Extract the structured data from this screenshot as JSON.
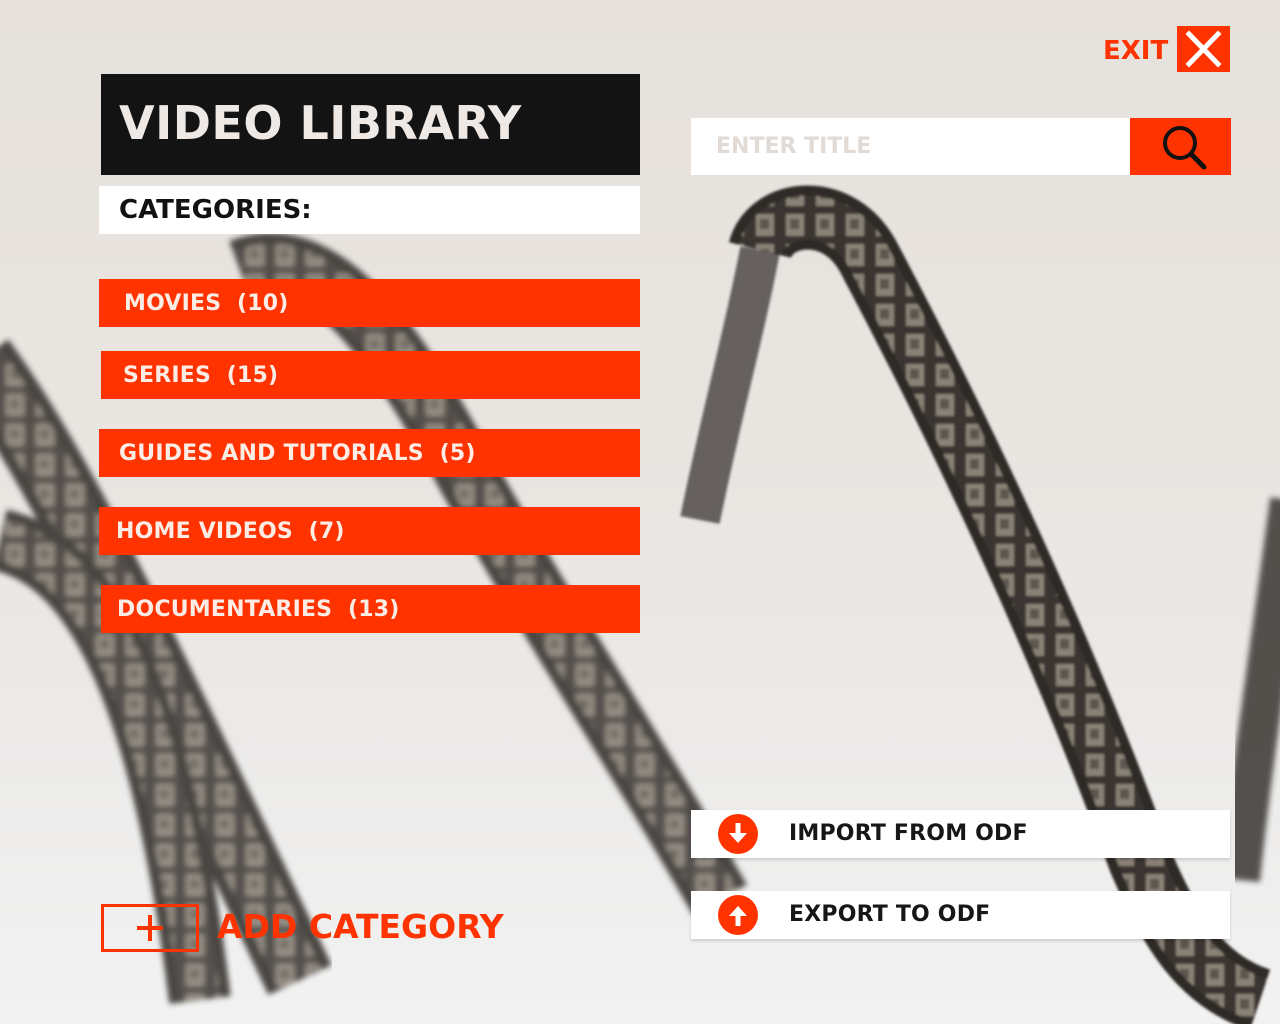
{
  "header": {
    "title": "VIDEO LIBRARY",
    "categories_heading": "CATEGORIES:"
  },
  "exit": {
    "label": "EXIT",
    "icon": "close-icon"
  },
  "search": {
    "placeholder": "ENTER TITLE",
    "value": "",
    "icon": "search-icon"
  },
  "categories": [
    {
      "label": "MOVIES  (10)"
    },
    {
      "label": "SERIES  (15)"
    },
    {
      "label": "GUIDES AND TUTORIALS  (5)"
    },
    {
      "label": "HOME VIDEOS  (7)"
    },
    {
      "label": "DOCUMENTARIES  (13)"
    }
  ],
  "actions": {
    "import_label": "IMPORT FROM ODF",
    "import_icon": "download-arrow-icon",
    "export_label": "EXPORT TO ODF",
    "export_icon": "upload-arrow-icon"
  },
  "add_category": {
    "label": "ADD CATEGORY",
    "icon": "plus-icon"
  },
  "colors": {
    "accent": "#ff3300",
    "title_bg": "#131313",
    "panel_bg": "#ffffff"
  }
}
